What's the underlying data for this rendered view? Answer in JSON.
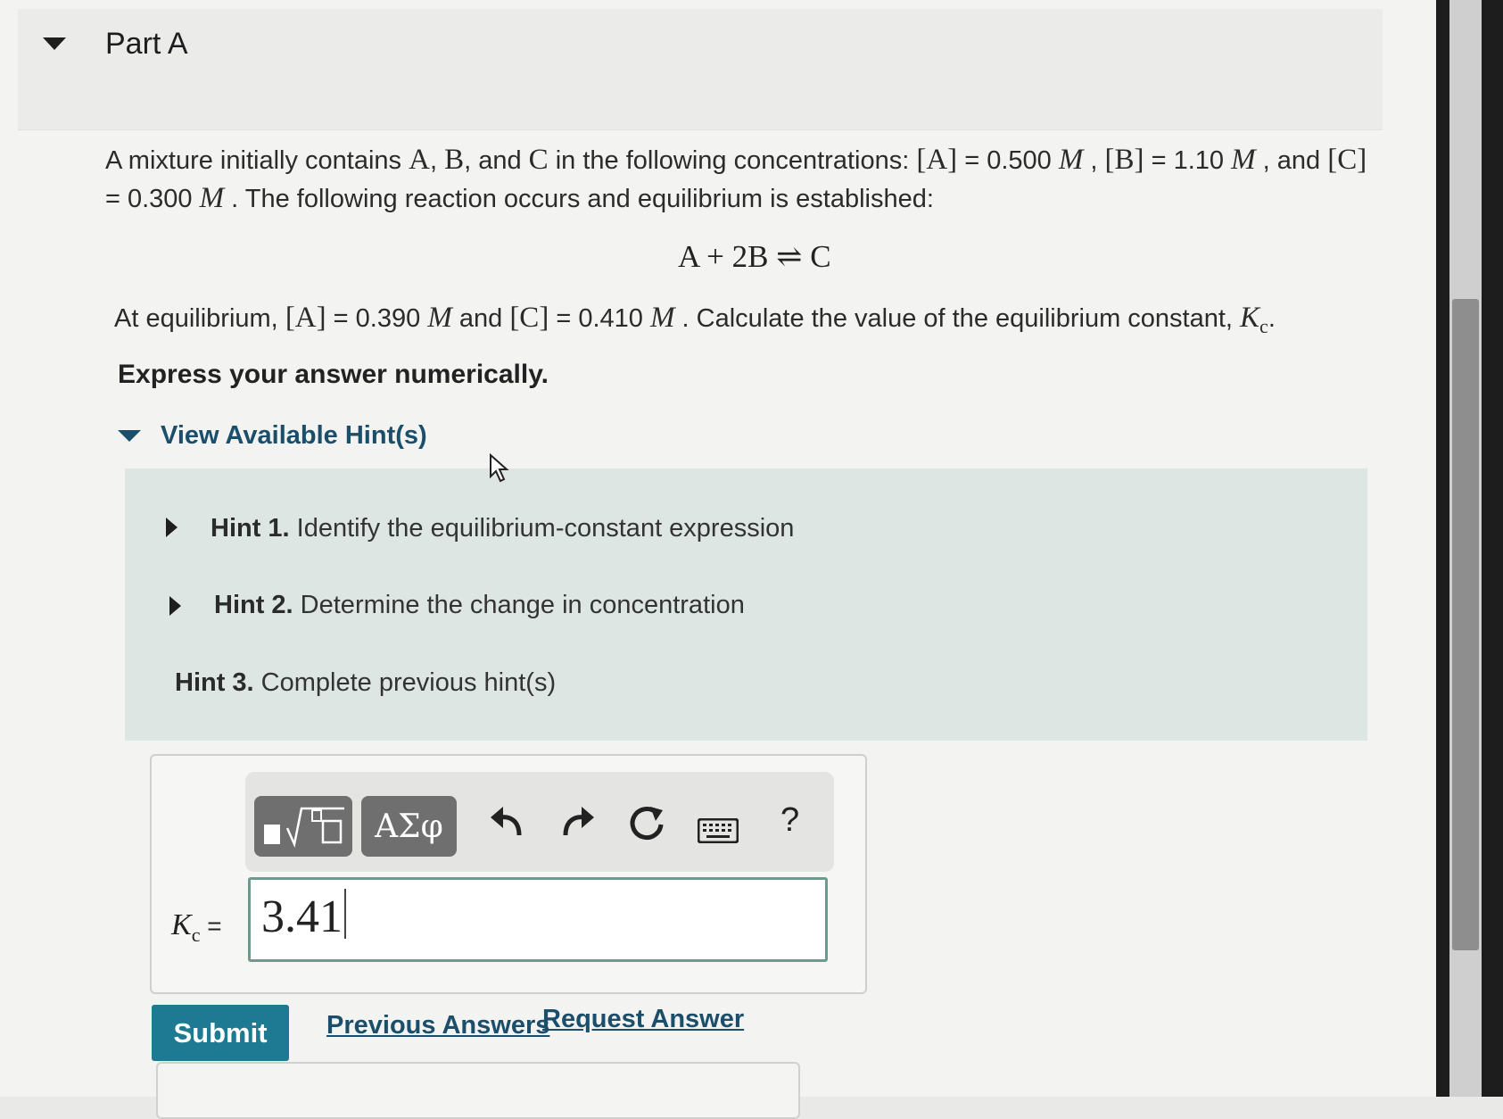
{
  "part": {
    "title": "Part A"
  },
  "problem": {
    "p1": "A mixture initially contains ",
    "A": "A",
    "sep1": ", ",
    "B": "B",
    "sep2": ", and ",
    "C": "C",
    "p2": " in the following concentrations: ",
    "a_conc_label": "[A]",
    "eq1": " = 0.500 ",
    "unit": "M",
    "sep3": " , ",
    "b_conc_label": "[B]",
    "eq2": " = 1.10 ",
    "sep4": " , and ",
    "c_conc_label": "[C]",
    "eq3": "= 0.300 ",
    "p3": " . The following reaction occurs and equilibrium is established:"
  },
  "reaction": "A + 2B ⇌ C",
  "equilibrium": {
    "p1": "At equilibrium, ",
    "a_label": "[A]",
    "a_val": " = 0.390 ",
    "unit": "M",
    "and": " and ",
    "c_label": "[C]",
    "c_val": " = 0.410 ",
    "p2": " . Calculate the value of the equilibrium constant, ",
    "K": "K",
    "sub": "c",
    "end": "."
  },
  "instruction": "Express your answer numerically.",
  "hints": {
    "toggle_label": "View Available Hint(s)",
    "items": [
      {
        "num": "Hint 1.",
        "text": " Identify the equilibrium-constant expression"
      },
      {
        "num": "Hint 2.",
        "text": " Determine the change in concentration"
      },
      {
        "num": "Hint 3.",
        "text": " Complete previous hint(s)"
      }
    ]
  },
  "toolbar": {
    "greek_label": "ΑΣφ",
    "help_label": "?"
  },
  "answer": {
    "label_K": "K",
    "label_sub": "c",
    "label_eq": " =",
    "value": "3.41"
  },
  "actions": {
    "submit": "Submit",
    "previous": "Previous Answers",
    "request": "Request Answer"
  },
  "colors": {
    "accent": "#1e7a93",
    "link": "#1b4e6b",
    "hint_bg": "#dde6e2",
    "input_border": "#6b9a8e"
  }
}
